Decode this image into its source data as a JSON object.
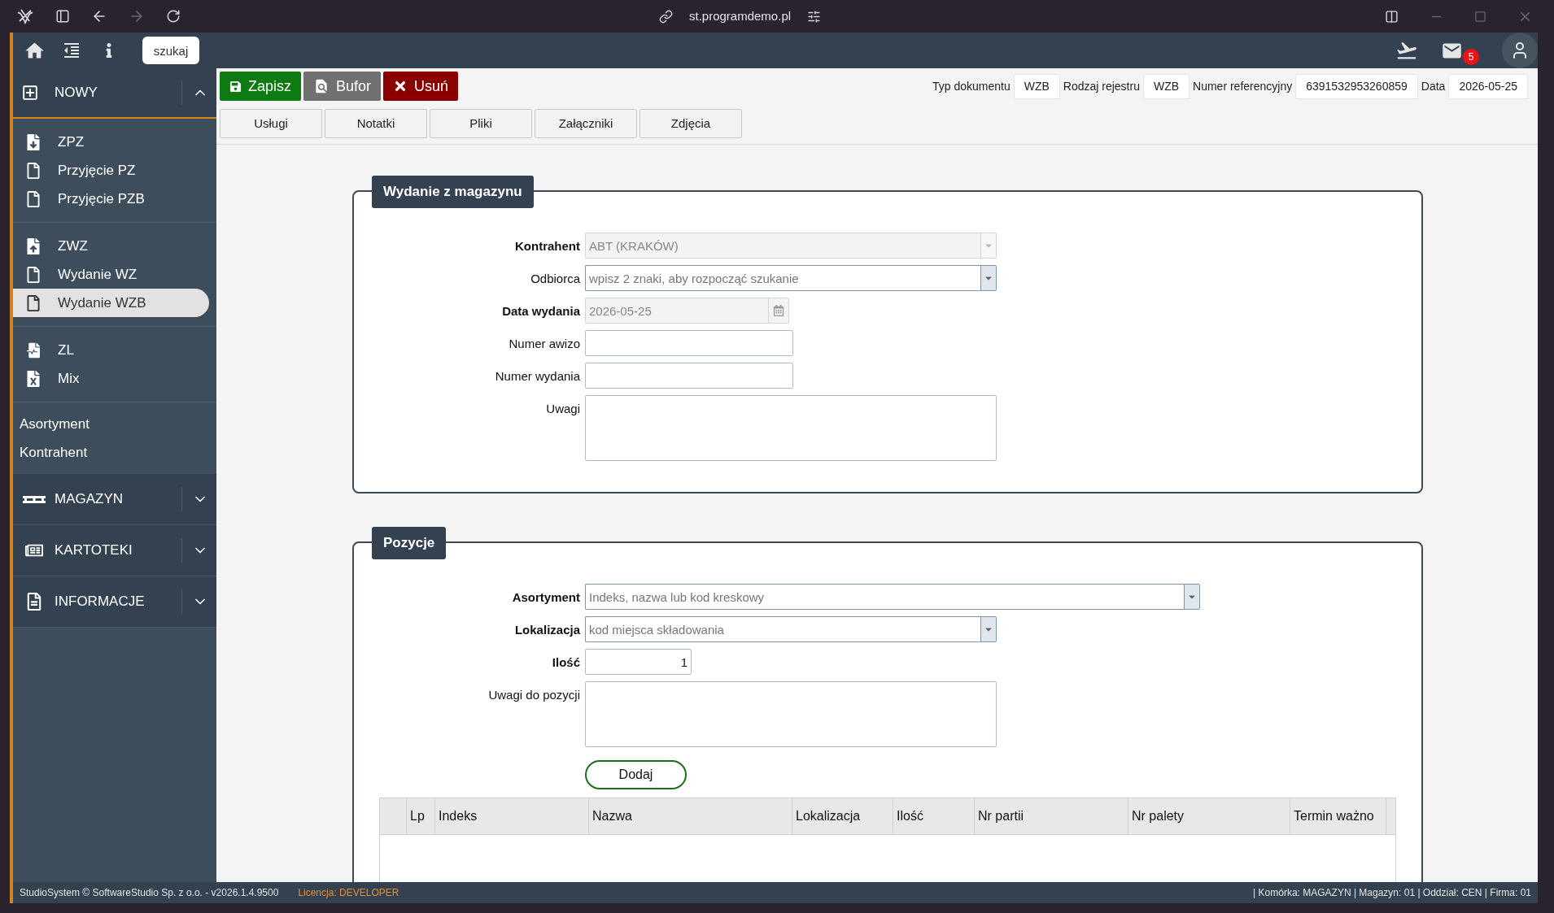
{
  "browser": {
    "url": "st.programdemo.pl"
  },
  "topbar": {
    "search_placeholder": "szukaj",
    "mail_count": "5"
  },
  "sidebar": {
    "new_section": {
      "title": "NOWY",
      "expanded": true
    },
    "groups": [
      {
        "items": [
          {
            "label": "ZPZ",
            "kind": "download",
            "selected": false
          },
          {
            "label": "Przyjęcie PZ",
            "kind": "doc",
            "selected": false
          },
          {
            "label": "Przyjęcie PZB",
            "kind": "doc",
            "selected": false
          }
        ]
      },
      {
        "items": [
          {
            "label": "ZWZ",
            "kind": "upload",
            "selected": false
          },
          {
            "label": "Wydanie WZ",
            "kind": "doc",
            "selected": false
          },
          {
            "label": "Wydanie WZB",
            "kind": "doc",
            "selected": true
          }
        ]
      },
      {
        "items": [
          {
            "label": "ZL",
            "kind": "pulse",
            "selected": false
          },
          {
            "label": "Mix",
            "kind": "excel",
            "selected": false
          }
        ]
      }
    ],
    "links": [
      "Asortyment",
      "Kontrahent"
    ],
    "sections": [
      {
        "title": "MAGAZYN",
        "kind": "pallet",
        "expanded": false
      },
      {
        "title": "KARTOTEKI",
        "kind": "cards",
        "expanded": false
      },
      {
        "title": "INFORMACJE",
        "kind": "info",
        "expanded": false
      }
    ]
  },
  "toolbar": {
    "buttons": [
      {
        "label": "Zapisz",
        "kind": "save"
      },
      {
        "label": "Bufor",
        "kind": "buffer"
      },
      {
        "label": "Usuń",
        "kind": "delete"
      }
    ],
    "tabs": [
      {
        "label": "Usługi",
        "selected": false
      },
      {
        "label": "Notatki",
        "selected": false
      },
      {
        "label": "Pliki",
        "selected": false
      },
      {
        "label": "Załączniki",
        "selected": false
      },
      {
        "label": "Zdjęcia",
        "selected": false
      }
    ],
    "doc_info": [
      {
        "label": "Typ dokumentu",
        "value": "WZB"
      },
      {
        "label": "Rodzaj rejestru",
        "value": "WZB"
      },
      {
        "label": "Numer referencyjny",
        "value": "6391532953260859"
      },
      {
        "label": "Data",
        "value": "2026-05-25"
      }
    ]
  },
  "issue_panel": {
    "title": "Wydanie z magazynu",
    "fields": [
      {
        "label": "Kontrahent",
        "kind": "combo",
        "required": true,
        "disabled": true,
        "wide": false,
        "value": "ABT (KRAKÓW)"
      },
      {
        "label": "Odbiorca",
        "kind": "combo",
        "required": false,
        "disabled": false,
        "wide": false,
        "placeholder": "wpisz 2 znaki, aby rozpocząć szukanie"
      },
      {
        "label": "Data wydania",
        "kind": "date",
        "required": true,
        "disabled": true,
        "value": "2026-05-25"
      },
      {
        "label": "Numer awizo",
        "kind": "text",
        "required": false,
        "disabled": false
      },
      {
        "label": "Numer wydania",
        "kind": "text",
        "required": false,
        "disabled": false
      },
      {
        "label": "Uwagi",
        "kind": "textarea",
        "required": false,
        "disabled": false
      }
    ]
  },
  "items_panel": {
    "title": "Pozycje",
    "fields": [
      {
        "label": "Asortyment",
        "kind": "combo",
        "required": true,
        "disabled": false,
        "wide": true,
        "placeholder": "Indeks, nazwa lub kod kreskowy"
      },
      {
        "label": "Lokalizacja",
        "kind": "combo",
        "required": true,
        "disabled": false,
        "wide": false,
        "placeholder": "kod miejsca składowania"
      },
      {
        "label": "Ilość",
        "kind": "number",
        "required": true,
        "disabled": false,
        "value": "1"
      },
      {
        "label": "Uwagi do pozycji",
        "kind": "textarea",
        "required": false,
        "disabled": false
      }
    ],
    "add_button": "Dodaj",
    "table": {
      "columns": [
        "",
        "Lp",
        "Indeks",
        "Nazwa",
        "Lokalizacja",
        "Ilość",
        "Nr partii",
        "Nr palety",
        "Termin ważno"
      ]
    }
  },
  "status_bar": {
    "version": "StudioSystem © SoftwareStudio Sp. z o.o. - v2026.1.4.9500",
    "license": "Licencja: DEVELOPER",
    "location": "| Komórka: MAGAZYN | Magazyn: 01 | Oddział: CEN | Firma: 01"
  }
}
